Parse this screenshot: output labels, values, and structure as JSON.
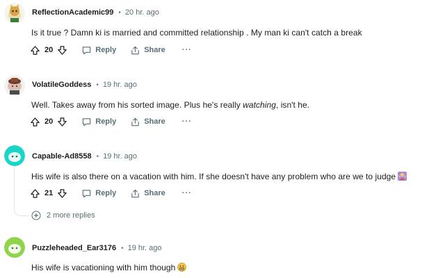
{
  "comments": [
    {
      "username": "ReflectionAcademic99",
      "separator": "•",
      "time": "20 hr. ago",
      "body": "Is it true ? Damn ki is married and committed relationship . My man ki can't catch a break",
      "votes": "20",
      "reply_label": "Reply",
      "share_label": "Share",
      "more_label": "···",
      "avatar_icon": "snoo-avatar-cat-icon"
    },
    {
      "username": "VolatileGoddess",
      "separator": "•",
      "time": "19 hr. ago",
      "body_before": "Well. Takes away from his sorted image. Plus he's really ",
      "body_em": "watching",
      "body_after": ", isn't he.",
      "votes": "20",
      "reply_label": "Reply",
      "share_label": "Share",
      "more_label": "···",
      "avatar_icon": "snoo-avatar-hat-icon"
    },
    {
      "username": "Capable-Ad8558",
      "separator": "•",
      "time": "19 hr. ago",
      "body": "His wife is also there on a vacation with him. If she doesn't have any problem who are we to judge",
      "emoji": "person-gesturing-emoji-icon",
      "votes": "21",
      "reply_label": "Reply",
      "share_label": "Share",
      "more_label": "···",
      "avatar_icon": "snoo-avatar-teal-icon",
      "more_replies": "2 more replies"
    },
    {
      "username": "Puzzleheaded_Ear3176",
      "separator": "•",
      "time": "19 hr. ago",
      "body": "His wife is vacationing with him though",
      "emoji": "grimacing-face-emoji-icon",
      "avatar_icon": "snoo-avatar-green-icon"
    }
  ],
  "colors": {
    "meta_text": "#576f76",
    "thread_line": "#e0e4e6",
    "avatar_teal": "#1cd4c8",
    "avatar_green": "#8fd44a"
  }
}
